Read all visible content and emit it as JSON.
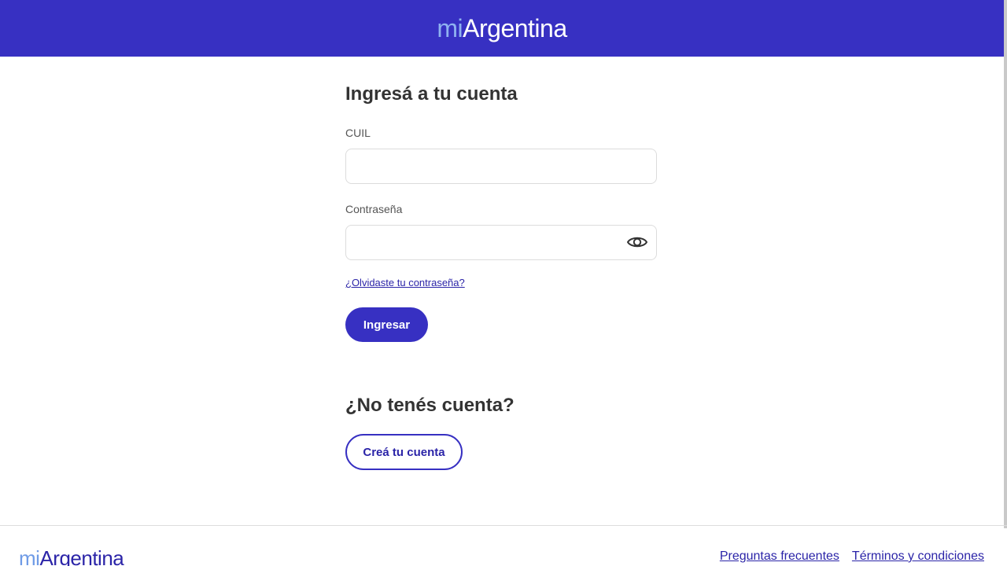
{
  "header": {
    "logo_prefix": "mi",
    "logo_main": "Argentina"
  },
  "login": {
    "title": "Ingresá a tu cuenta",
    "cuil_label": "CUIL",
    "cuil_value": "",
    "password_label": "Contraseña",
    "password_value": "",
    "show_password_icon": "eye-icon",
    "forgot_link": "¿Olvidaste tu contraseña?",
    "submit_label": "Ingresar"
  },
  "signup": {
    "title": "¿No tenés cuenta?",
    "button_label": "Creá tu cuenta"
  },
  "footer": {
    "logo_prefix": "mi",
    "logo_main": "Argentina",
    "links": [
      "Preguntas frecuentes",
      "Términos y condiciones"
    ]
  },
  "colors": {
    "primary": "#3730c2",
    "link": "#2b24a8",
    "logo_light": "#8fb2f0",
    "text": "#333333"
  }
}
